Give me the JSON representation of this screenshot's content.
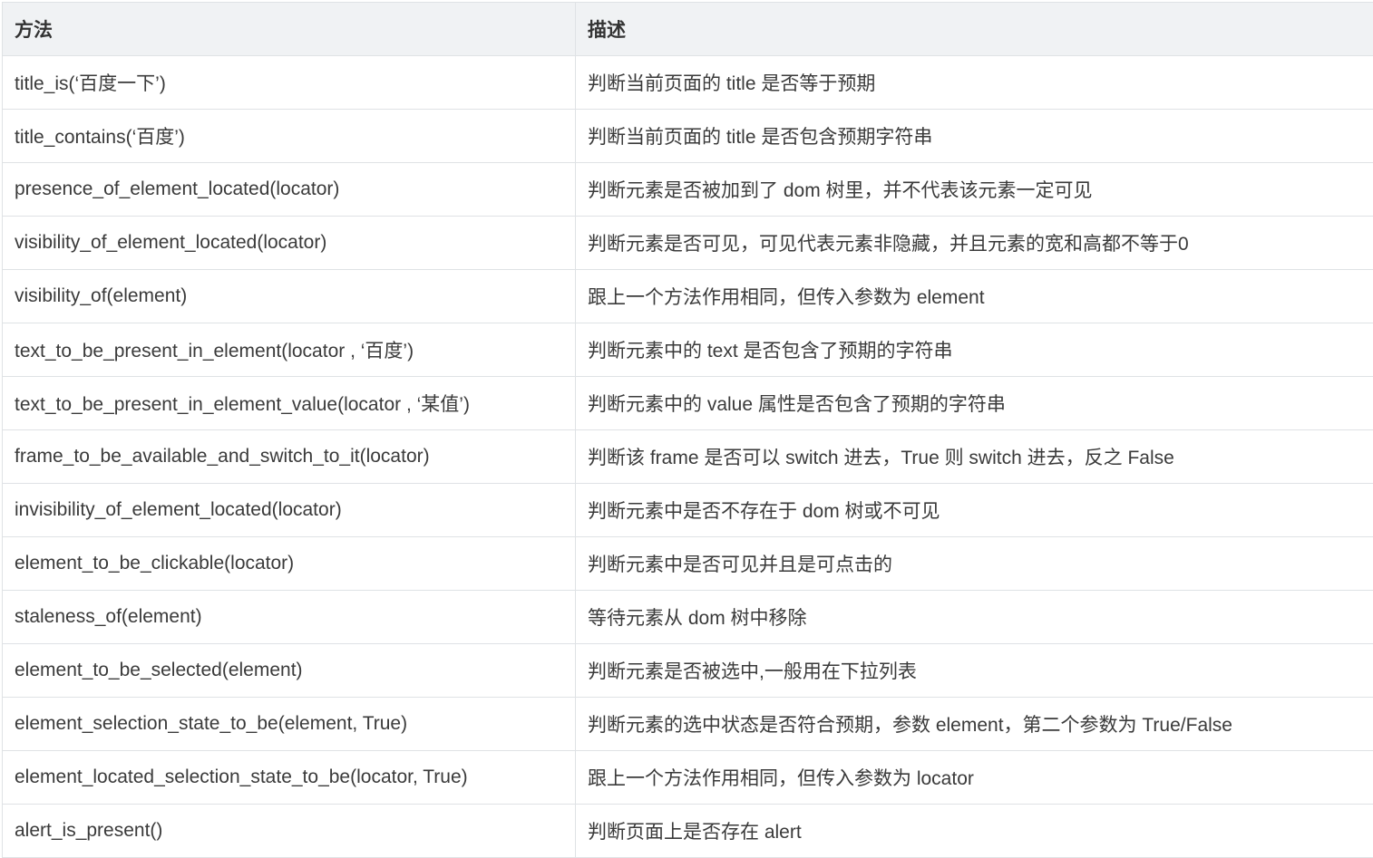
{
  "table": {
    "headers": [
      "方法",
      "描述"
    ],
    "rows": [
      [
        "title_is(‘百度一下’)",
        "判断当前页面的 title 是否等于预期"
      ],
      [
        "title_contains(‘百度’)",
        "判断当前页面的 title 是否包含预期字符串"
      ],
      [
        "presence_of_element_located(locator)",
        "判断元素是否被加到了 dom 树里，并不代表该元素一定可见"
      ],
      [
        "visibility_of_element_located(locator)",
        "判断元素是否可见，可见代表元素非隐藏，并且元素的宽和高都不等于0"
      ],
      [
        "visibility_of(element)",
        "跟上一个方法作用相同，但传入参数为 element"
      ],
      [
        "text_to_be_present_in_element(locator , ‘百度’)",
        "判断元素中的 text 是否包含了预期的字符串"
      ],
      [
        "text_to_be_present_in_element_value(locator , ‘某值’)",
        "判断元素中的 value 属性是否包含了预期的字符串"
      ],
      [
        "frame_to_be_available_and_switch_to_it(locator)",
        "判断该 frame 是否可以 switch 进去，True 则 switch 进去，反之 False"
      ],
      [
        "invisibility_of_element_located(locator)",
        "判断元素中是否不存在于 dom 树或不可见"
      ],
      [
        "element_to_be_clickable(locator)",
        "判断元素中是否可见并且是可点击的"
      ],
      [
        "staleness_of(element)",
        "等待元素从 dom 树中移除"
      ],
      [
        "element_to_be_selected(element)",
        "判断元素是否被选中,一般用在下拉列表"
      ],
      [
        "element_selection_state_to_be(element, True)",
        "判断元素的选中状态是否符合预期，参数 element，第二个参数为 True/False"
      ],
      [
        "element_located_selection_state_to_be(locator, True)",
        "跟上一个方法作用相同，但传入参数为 locator"
      ],
      [
        "alert_is_present()",
        "判断页面上是否存在 alert"
      ]
    ]
  }
}
